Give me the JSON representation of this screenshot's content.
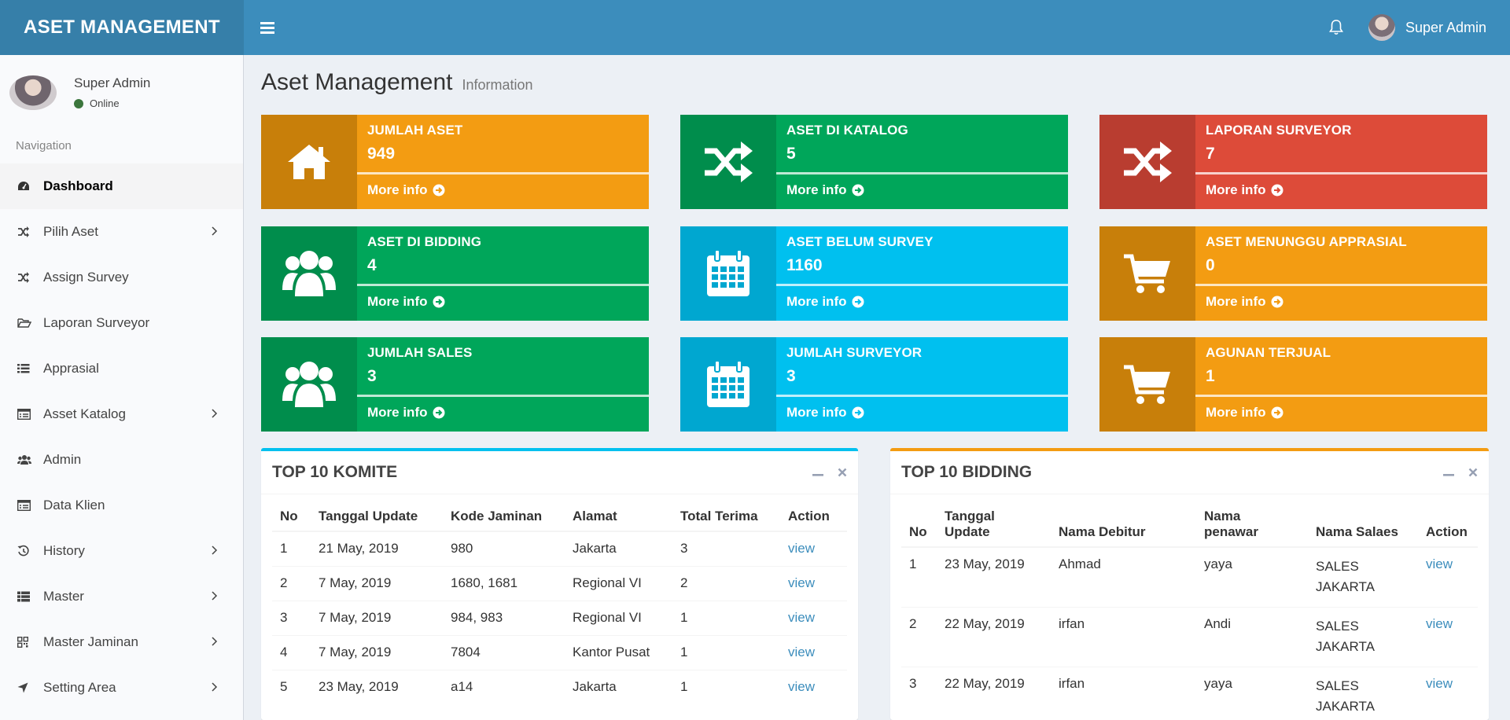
{
  "app": {
    "title": "ASET MANAGEMENT"
  },
  "header": {
    "user_name": "Super Admin"
  },
  "sidebar": {
    "user_name": "Super Admin",
    "status": "Online",
    "nav_header": "Navigation",
    "items": [
      {
        "label": "Dashboard",
        "icon": "dashboard-icon"
      },
      {
        "label": "Pilih Aset",
        "icon": "random-icon"
      },
      {
        "label": "Assign Survey",
        "icon": "random-icon"
      },
      {
        "label": "Laporan Surveyor",
        "icon": "folder-open-icon"
      },
      {
        "label": "Apprasial",
        "icon": "list-icon"
      },
      {
        "label": "Asset Katalog",
        "icon": "list-alt-icon"
      },
      {
        "label": "Admin",
        "icon": "users-icon"
      },
      {
        "label": "Data Klien",
        "icon": "list-alt-icon"
      },
      {
        "label": "History",
        "icon": "history-icon"
      },
      {
        "label": "Master",
        "icon": "th-list-icon"
      },
      {
        "label": "Master Jaminan",
        "icon": "qrcode-icon"
      },
      {
        "label": "Setting Area",
        "icon": "location-arrow-icon"
      }
    ]
  },
  "page": {
    "title": "Aset Management",
    "subtitle": "Information"
  },
  "infoboxes": [
    {
      "title": "JUMLAH ASET",
      "value": "949",
      "more": "More info",
      "icon": "home-icon",
      "color": "#f39c12"
    },
    {
      "title": "ASET DI KATALOG",
      "value": "5",
      "more": "More info",
      "icon": "random-icon",
      "color": "#00a65a"
    },
    {
      "title": "LAPORAN SURVEYOR",
      "value": "7",
      "more": "More info",
      "icon": "random-icon",
      "color": "#dd4b39"
    },
    {
      "title": "ASET DI BIDDING",
      "value": "4",
      "more": "More info",
      "icon": "users-icon",
      "color": "#00a65a"
    },
    {
      "title": "ASET BELUM SURVEY",
      "value": "1160",
      "more": "More info",
      "icon": "calendar-icon",
      "color": "#00c0ef"
    },
    {
      "title": "ASET MENUNGGU APPRASIAL",
      "value": "0",
      "more": "More info",
      "icon": "cart-icon",
      "color": "#f39c12"
    },
    {
      "title": "JUMLAH SALES",
      "value": "3",
      "more": "More info",
      "icon": "users-icon",
      "color": "#00a65a"
    },
    {
      "title": "JUMLAH SURVEYOR",
      "value": "3",
      "more": "More info",
      "icon": "calendar-icon",
      "color": "#00c0ef"
    },
    {
      "title": "AGUNAN TERJUAL",
      "value": "1",
      "more": "More info",
      "icon": "cart-icon",
      "color": "#f39c12"
    }
  ],
  "komite": {
    "title": "TOP 10 KOMITE",
    "columns": [
      "No",
      "Tanggal Update",
      "Kode Jaminan",
      "Alamat",
      "Total Terima",
      "Action"
    ],
    "rows": [
      [
        "1",
        "21 May, 2019",
        "980",
        "Jakarta",
        "3",
        "view"
      ],
      [
        "2",
        "7 May, 2019",
        "1680, 1681",
        "Regional VI",
        "2",
        "view"
      ],
      [
        "3",
        "7 May, 2019",
        "984, 983",
        "Regional VI",
        "1",
        "view"
      ],
      [
        "4",
        "7 May, 2019",
        "7804",
        "Kantor Pusat",
        "1",
        "view"
      ],
      [
        "5",
        "23 May, 2019",
        "a14",
        "Jakarta",
        "1",
        "view"
      ]
    ]
  },
  "bidding": {
    "title": "TOP 10 BIDDING",
    "columns": [
      "No",
      "Tanggal Update",
      "Nama Debitur",
      "Nama penawar",
      "Nama Salaes",
      "Action"
    ],
    "rows": [
      [
        "1",
        "23 May, 2019",
        "Ahmad",
        "yaya",
        "SALES JAKARTA",
        "view"
      ],
      [
        "2",
        "22 May, 2019",
        "irfan",
        "Andi",
        "SALES JAKARTA",
        "view"
      ],
      [
        "3",
        "22 May, 2019",
        "irfan",
        "yaya",
        "SALES JAKARTA",
        "view"
      ]
    ]
  }
}
